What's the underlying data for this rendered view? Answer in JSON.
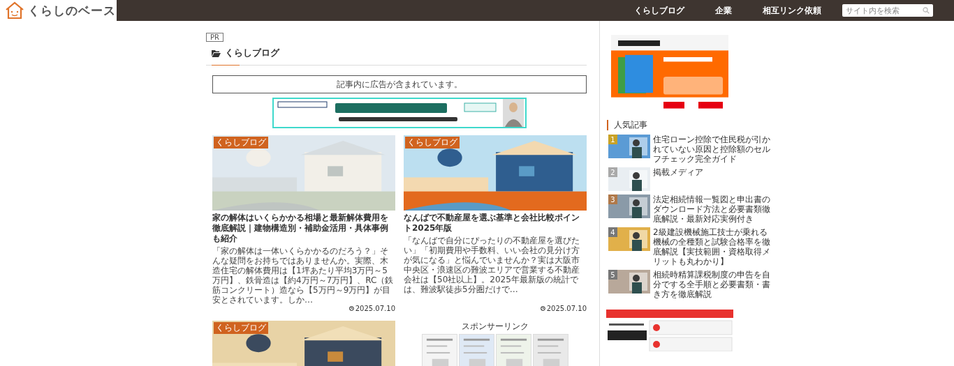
{
  "header": {
    "logo": "くらしのベース",
    "nav": [
      {
        "label": "くらしブログ"
      },
      {
        "label": "企業"
      },
      {
        "label": "相互リンク依頼"
      }
    ],
    "search": {
      "placeholder": "サイト内を検索"
    }
  },
  "main": {
    "pr_label": "PR",
    "heading": "くらしブログ",
    "notice": "記事内に広告が含まれています。",
    "articles": [
      {
        "category": "くらしブログ",
        "title": "家の解体はいくらかかる相場と最新解体費用を徹底解説｜建物構造別・補助金活用・具体事例も紹介",
        "excerpt": "「家の解体は一体いくらかかるのだろう？」そんな疑問をお持ちではありませんか。実際、木造住宅の解体費用は【1坪あたり平均3万円～5万円】、鉄骨造は【約4万円～7万円】、RC（鉄筋コンクリート）造なら【5万円～9万円】が目安とされています。しか…",
        "date": "2025.07.10"
      },
      {
        "category": "くらしブログ",
        "title": "なんばで不動産屋を選ぶ基準と会社比較ポイント2025年版",
        "excerpt": "「なんばで自分にぴったりの不動産屋を選びたい」「初期費用や手数料、いい会社の見分け方が気になる」と悩んでいませんか？実は大阪市中央区・浪速区の難波エリアで営業する不動産会社は【50社以上】。2025年最新版の統計では、難波駅徒歩5分圏だけで…",
        "date": "2025.07.10"
      },
      {
        "category": "くらしブログ"
      }
    ],
    "sponsor": {
      "label": "スポンサーリンク"
    }
  },
  "sidebar": {
    "popular_heading": "人気記事",
    "popular": [
      {
        "rank": "1",
        "color": "#c9a227",
        "title": "住宅ローン控除で住民税が引かれていない原因と控除額のセルフチェック完全ガイド"
      },
      {
        "rank": "2",
        "color": "#a9a9a9",
        "title": "掲載メディア"
      },
      {
        "rank": "3",
        "color": "#b0794a",
        "title": "法定相続情報一覧図と申出書のダウンロード方法と必要書類徹底解説・最新対応実例付き"
      },
      {
        "rank": "4",
        "color": "#777777",
        "title": "2級建設機械施工技士が乗れる機械の全種類と試験合格率を徹底解説【実技範囲・資格取得メリットも丸わかり】"
      },
      {
        "rank": "5",
        "color": "#777777",
        "title": "相続時精算課税制度の申告を自分でする全手順と必要書類・書き方を徹底解説"
      }
    ]
  }
}
